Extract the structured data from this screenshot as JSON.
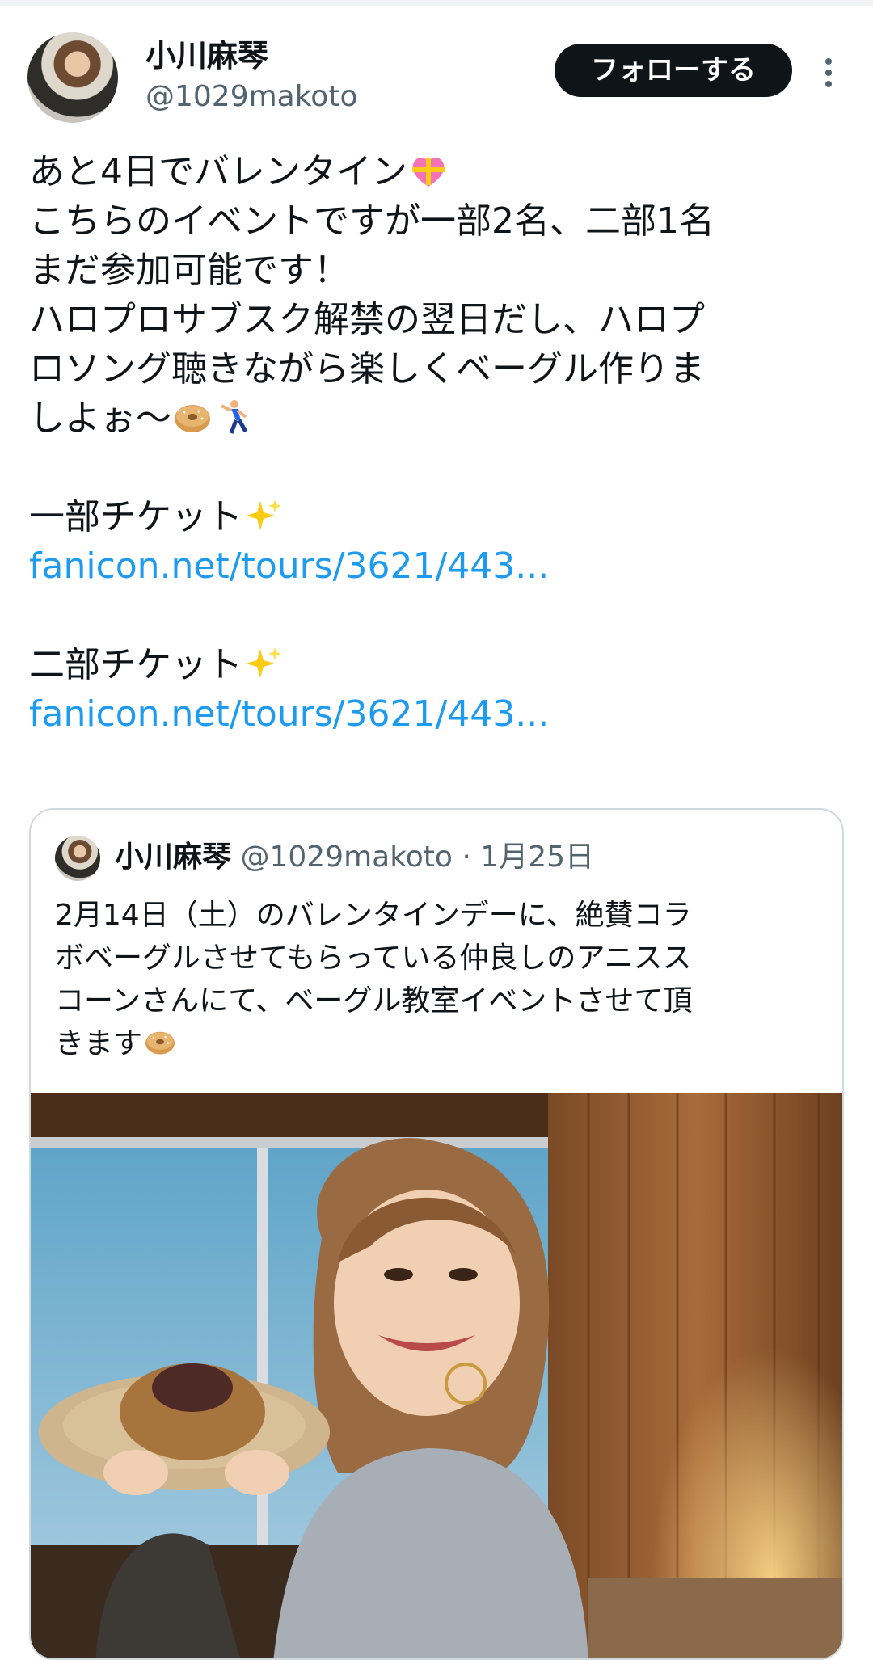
{
  "tweet": {
    "author": {
      "name": "小川麻琴",
      "handle": "@1029makoto"
    },
    "follow_label": "フォローする",
    "body_lines": [
      {
        "text": "あと4日でバレンタイン",
        "emoji": [
          "heart-ribbon"
        ]
      },
      {
        "text": "こちらのイベントですが一部2名、二部1名"
      },
      {
        "text": "まだ参加可能です！"
      },
      {
        "text": "ハロプロサブスク解禁の翌日だし、ハロプ"
      },
      {
        "text": "ロソング聴きながら楽しくベーグル作りま"
      },
      {
        "text": "しよぉ〜",
        "emoji": [
          "bagel",
          "dancer"
        ]
      },
      {
        "text": ""
      },
      {
        "text": "一部チケット",
        "emoji": [
          "sparkles"
        ]
      },
      {
        "text": "fanicon.net/tours/3621/443...",
        "link": true
      },
      {
        "text": ""
      },
      {
        "text": "二部チケット",
        "emoji": [
          "sparkles"
        ]
      },
      {
        "text": "fanicon.net/tours/3621/443...",
        "link": true
      }
    ]
  },
  "quoted_tweet": {
    "author": {
      "name": "小川麻琴",
      "handle": "@1029makoto"
    },
    "date": "· 1月25日",
    "text_lines": [
      "2月14日（土）のバレンタインデーに、絶賛コラ",
      "ボベーグルさせてもらっている仲良しのアニスス",
      "コーンさんにて、ベーグル教室イベントさせて頂",
      "きます"
    ],
    "text_end_emoji": "bagel"
  },
  "colors": {
    "link": "#1d9bf0",
    "secondary_text": "#536471",
    "border": "#cfd9de",
    "button_bg": "#0f1419"
  }
}
